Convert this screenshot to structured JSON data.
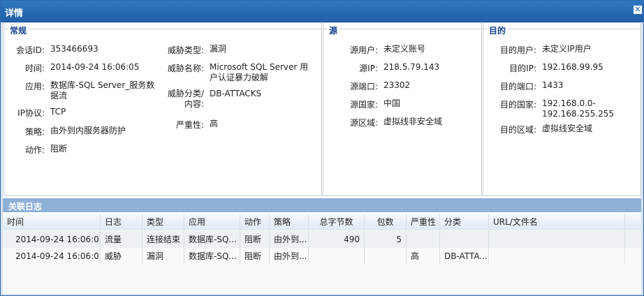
{
  "window": {
    "title": "详情"
  },
  "general": {
    "legend": "常规",
    "left_fields": [
      {
        "label": "会话ID:",
        "value": "353466693"
      },
      {
        "label": "时间:",
        "value": "2014-09-24 16:06:05"
      },
      {
        "label": "应用:",
        "value": "数据库-SQL Server_服务数据流"
      },
      {
        "label": "IP协议:",
        "value": "TCP"
      },
      {
        "label": "策略:",
        "value": "由外到内服务器防护"
      },
      {
        "label": "动作:",
        "value": "阻断"
      }
    ],
    "right_fields": [
      {
        "label": "威胁类型:",
        "value": "漏洞"
      },
      {
        "label": "威胁名称:",
        "value": "Microsoft SQL Server 用户认证暴力破解"
      },
      {
        "label": "威胁分类/内容:",
        "value": "DB-ATTACKS"
      },
      {
        "label": "严重性:",
        "value": "高"
      }
    ]
  },
  "source": {
    "legend": "源",
    "fields": [
      {
        "label": "源用户:",
        "value": "未定义账号"
      },
      {
        "label": "源IP:",
        "value": "218.5.79.143"
      },
      {
        "label": "源端口:",
        "value": "23302"
      },
      {
        "label": "源国家:",
        "value": "中国"
      },
      {
        "label": "源区域:",
        "value": "虚拟线非安全域"
      }
    ]
  },
  "destination": {
    "legend": "目的",
    "fields": [
      {
        "label": "目的用户:",
        "value": "未定义IP用户"
      },
      {
        "label": "目的IP:",
        "value": "192.168.99.95"
      },
      {
        "label": "目的端口:",
        "value": "1433"
      },
      {
        "label": "目的国家:",
        "value": "192.168.0.0-192.168.255.255"
      },
      {
        "label": "目的区域:",
        "value": "虚拟线安全域"
      }
    ]
  },
  "logs": {
    "title": "关联日志",
    "columns": [
      "时间",
      "日志",
      "类型",
      "应用",
      "动作",
      "策略",
      "总字节数",
      "包数",
      "严重性",
      "分类",
      "URL/文件名"
    ],
    "rows": [
      [
        "2014-09-24 16:06:05",
        "流量",
        "连接结束",
        "数据库-SQ...",
        "阻断",
        "由外到...",
        "490",
        "5",
        "",
        "",
        ""
      ],
      [
        "2014-09-24 16:06:05",
        "威胁",
        "漏洞",
        "数据库-SQ...",
        "阻断",
        "由外到...",
        "",
        "",
        "高",
        "DB-ATTA...",
        ""
      ]
    ]
  }
}
